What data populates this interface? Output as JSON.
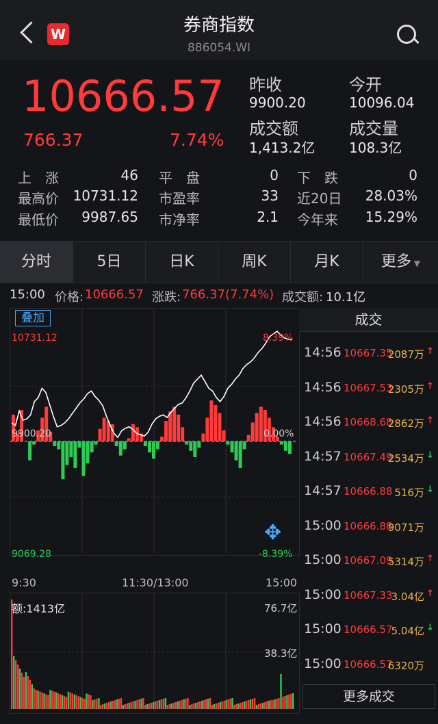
{
  "header": {
    "title": "券商指数",
    "code": "886054.WI",
    "logo_letter": "W"
  },
  "quote": {
    "price": "10666.57",
    "change": "766.37",
    "change_pct": "7.74%",
    "prev_close_label": "昨收",
    "prev_close": "9900.20",
    "open_label": "今开",
    "open": "10096.04",
    "turnover_label": "成交额",
    "turnover": "1,413.2亿",
    "volume_label": "成交量",
    "volume": "108.3亿"
  },
  "stats": [
    {
      "label": "上　涨",
      "value": "46",
      "label2": "平　盘",
      "value2": "0",
      "label3": "下　跌",
      "value3": "0"
    },
    {
      "label": "最高价",
      "value": "10731.12",
      "label2": "市盈率",
      "value2": "33",
      "label3": "近20日",
      "value3": "28.03%"
    },
    {
      "label": "最低价",
      "value": "9987.65",
      "label2": "市净率",
      "value2": "2.1",
      "label3": "今年来",
      "value3": "15.29%"
    }
  ],
  "tabs": [
    "分时",
    "5日",
    "日K",
    "周K",
    "月K",
    "更多"
  ],
  "infobar": {
    "time": "15:00",
    "price_label": "价格:",
    "price": "10666.57",
    "change_label": "涨跌:",
    "change": "766.37(7.74%)",
    "amount_label": "成交额:",
    "amount": "10.1亿"
  },
  "chart": {
    "overlay_label": "叠加",
    "y_top": "10731.12",
    "y_mid": "9900.20",
    "y_bot": "9069.28",
    "pct_top": "8.39%",
    "pct_mid": "0.00%",
    "pct_bot": "-8.39%",
    "x_labels": [
      "9:30",
      "11:30/13:00",
      "15:00"
    ],
    "volume_label": "额:1413亿",
    "vol_top": "76.7亿",
    "vol_mid": "38.3亿"
  },
  "chart_data": {
    "type": "line",
    "series": [
      {
        "values": [
          10040,
          10020,
          10130,
          10060,
          10070,
          10100,
          10200,
          10230,
          10300,
          10270,
          10180,
          10090,
          10010,
          10020,
          10040,
          10070,
          10110,
          10150,
          10190,
          10220,
          10260,
          10280,
          10240,
          10210,
          10170,
          10090,
          10020,
          9960,
          9930,
          9980,
          10000,
          10010,
          9990,
          9960,
          9950,
          9940,
          9970,
          10030,
          10070,
          10090,
          10100,
          10080,
          10120,
          10150,
          10180,
          10190,
          10230,
          10280,
          10340,
          10370,
          10400,
          10350,
          10300,
          10280,
          10230,
          10200,
          10240,
          10300,
          10330,
          10370,
          10400,
          10450,
          10480,
          10500,
          10530,
          10570,
          10600,
          10640,
          10690,
          10710,
          10731,
          10700,
          10680,
          10670,
          10666.57
        ]
      }
    ],
    "ylim": [
      9069.28,
      10731.12
    ],
    "xlabel": "",
    "ylabel": ""
  },
  "trades": {
    "title": "成交",
    "more_label": "更多成交",
    "rows": [
      {
        "time": "14:56",
        "price": "10667.35",
        "vol": "2087万",
        "dir": "up"
      },
      {
        "time": "14:56",
        "price": "10667.53",
        "vol": "2305万",
        "dir": "up"
      },
      {
        "time": "14:56",
        "price": "10668.68",
        "vol": "2862万",
        "dir": "up"
      },
      {
        "time": "14:57",
        "price": "10667.49",
        "vol": "2534万",
        "dir": "down"
      },
      {
        "time": "14:57",
        "price": "10666.88",
        "vol": "516万",
        "dir": "down"
      },
      {
        "time": "15:00",
        "price": "10666.88",
        "vol": "9071万",
        "dir": "none"
      },
      {
        "time": "15:00",
        "price": "10667.09",
        "vol": "5314万",
        "dir": "up"
      },
      {
        "time": "15:00",
        "price": "10667.33",
        "vol": "3.04亿",
        "dir": "up"
      },
      {
        "time": "15:00",
        "price": "10666.57",
        "vol": "5.04亿",
        "dir": "down"
      },
      {
        "time": "15:00",
        "price": "10666.57",
        "vol": "6320万",
        "dir": "none"
      }
    ]
  },
  "colors": {
    "up": "#ff3b3b",
    "down": "#2ecc55",
    "accent": "#4aa8ff",
    "volume": "#e8b84a"
  }
}
